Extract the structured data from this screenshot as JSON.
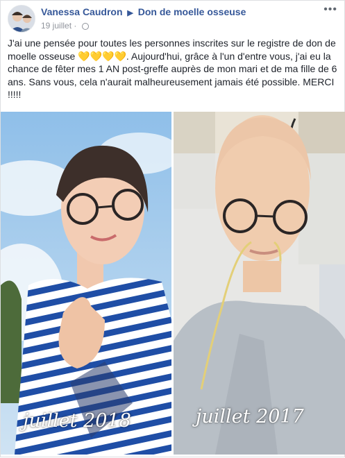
{
  "post": {
    "author": "Vanessa Caudron",
    "group": "Don de moelle osseuse",
    "date": "19 juillet",
    "separator": "·",
    "more_glyph": "•••",
    "message": "J'ai une pensée pour toutes les personnes inscrites sur le registre de don de moelle osseuse 💛💛💛💛. Aujourd'hui, grâce à l'un d'entre vous, j'ai eu la chance de fêter mes 1 AN post-greffe auprès de mon mari et de ma fille de 6 ans. Sans vous, cela n'aurait malheureusement jamais été possible. MERCI !!!!!"
  },
  "photos": [
    {
      "caption": "juillet 2018"
    },
    {
      "caption": "juillet 2017"
    }
  ],
  "colors": {
    "link": "#365899",
    "muted": "#90949c",
    "text": "#1d2129",
    "sky": "#9fc6ea",
    "stripe_blue": "#1f4ea6",
    "hospital_wall": "#e9e3d6"
  },
  "icons": [
    "avatar",
    "right-triangle-icon",
    "globe-icon",
    "more-options-icon"
  ]
}
